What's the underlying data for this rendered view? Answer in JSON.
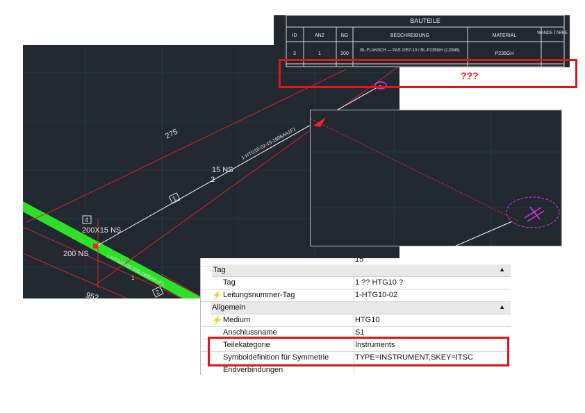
{
  "bom_table": {
    "title": "BAUTEILE",
    "headers": [
      "ID",
      "ANZ",
      "NG",
      "BESCHREIBUNG",
      "MATERIAL",
      "WANDS TÄRKE"
    ],
    "row": [
      "3",
      "1",
      "200",
      "BL-FLANSCH — PAS 1057-10 / BL-P235GH (1.0345)",
      "P235GH",
      ""
    ]
  },
  "callout": {
    "text": "???"
  },
  "cad_main": {
    "dim_top": "275",
    "label_ns15": "15 NS",
    "label_ns15_sub": "2",
    "pipe_tag_upper": "1-HTG10-02-15-1606AA1F1",
    "pipe_tag_lower": "1-HTG10-02-200-1606AA1F1",
    "item_box_1": "1",
    "item_box_4": "4",
    "label_200x15": "200X15 NS",
    "label_200ns": "200 NS",
    "dim_bottom": "952",
    "item_box_2": "2",
    "small_label": "1"
  },
  "colors": {
    "cad_bg": "#212830",
    "red_line": "#d6262c",
    "green_pipe": "#2fe02a",
    "magenta": "#e033e0",
    "highlight": "#e2151b"
  },
  "properties": {
    "top_row_value": "15",
    "categories": [
      {
        "label": "Tag",
        "rows": [
          {
            "name": "Tag",
            "value": "1 ?? HTG10 ?",
            "bolt": false
          },
          {
            "name": "Leitungsnummer-Tag",
            "value": "1-HTG10-02",
            "bolt": true
          }
        ]
      },
      {
        "label": "Allgemein",
        "rows": [
          {
            "name": "Medium",
            "value": "HTG10",
            "bolt": true
          },
          {
            "name": "Anschlussname",
            "value": "S1",
            "bolt": false
          },
          {
            "name": "Teilekategorie",
            "value": "Instruments",
            "bolt": false
          },
          {
            "name": "Symboldefinition für Symmetrie",
            "value": "TYPE=INSTRUMENT,SKEY=ITSC",
            "bolt": false
          },
          {
            "name": "Endverbindungen",
            "value": "",
            "bolt": false
          }
        ]
      }
    ],
    "collapse_glyph": "▲"
  }
}
